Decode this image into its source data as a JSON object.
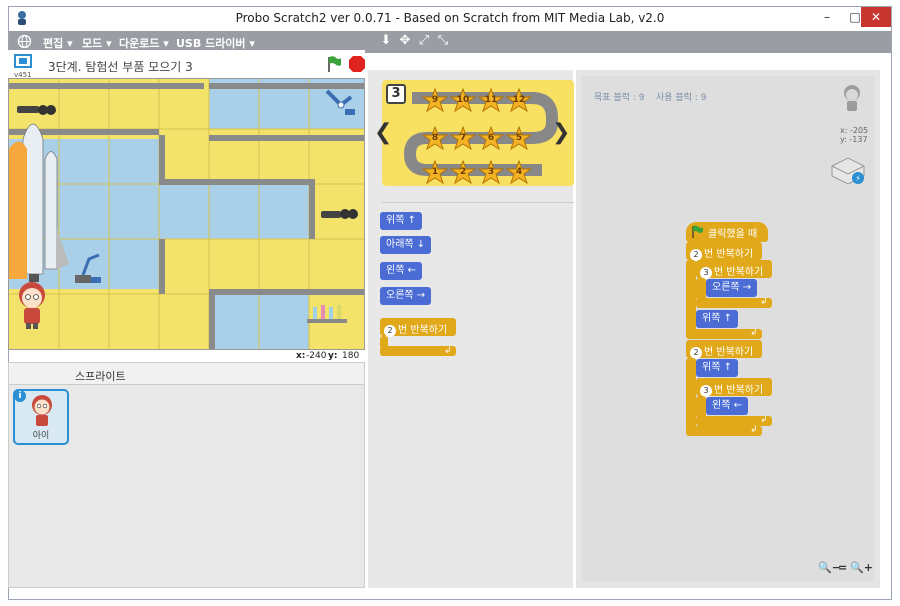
{
  "window": {
    "title": "Probo Scratch2 ver 0.0.71 - Based on Scratch from MIT Media Lab, v2.0",
    "minimize": "–",
    "maximize": "□",
    "close": "✕"
  },
  "menu": {
    "items": [
      {
        "label": "편집 ▾"
      },
      {
        "label": "모드 ▾"
      },
      {
        "label": "다운로드 ▾"
      },
      {
        "label": "USB 드라이버 ▾"
      }
    ],
    "tools": [
      "stamp-icon",
      "cut-icon",
      "grow-icon",
      "shrink-icon"
    ]
  },
  "stage": {
    "version": "v451",
    "title": "3단계. 탐험선 부품 모으기 3",
    "coords": {
      "x_label": "x:",
      "x": "-240",
      "y_label": "y:",
      "y": "180"
    }
  },
  "sprites": {
    "header": "스프라이트",
    "items": [
      {
        "name": "아이"
      }
    ]
  },
  "level": {
    "number": "3",
    "stars": [
      "9",
      "10",
      "11",
      "12",
      "8",
      "7",
      "6",
      "5",
      "1",
      "2",
      "3",
      "4"
    ]
  },
  "palette_blocks": {
    "up": "위쪽 ↑",
    "down": "아래쪽 ↓",
    "left": "왼쪽 ←",
    "right": "오른쪽 →",
    "repeat_num": "2",
    "repeat": "번 반복하기",
    "repeat_end": "↲"
  },
  "script": {
    "goal_label": "목표 블럭 :",
    "goal_value": "9",
    "used_label": "사용 블럭 :",
    "used_value": "9",
    "sprite_x": "x: -205",
    "sprite_y": "y: -137",
    "hat": "클릭했을 때",
    "repeat1_num": "2",
    "repeat2_num": "3",
    "repeat3_num": "2",
    "repeat4_num": "3",
    "repeat_label": "번 반복하기",
    "right": "오른쪽 →",
    "up1": "위쪽 ↑",
    "up2": "위쪽 ↑",
    "left": "왼쪽 ←",
    "end_arrow": "↲",
    "zoom_out": "🔍−",
    "zoom_reset": "=",
    "zoom_in": "🔍+"
  },
  "colors": {
    "motion": "#4a6cd4",
    "control": "#e1a91a",
    "menubar": "#9a9ea4",
    "close": "#c7372f"
  }
}
